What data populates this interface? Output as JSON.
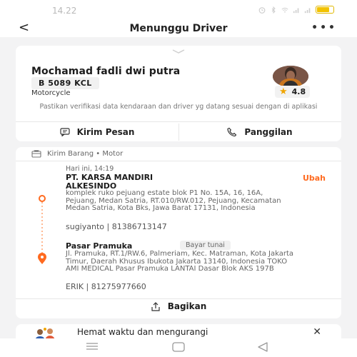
{
  "status_bar": {
    "time": "14.22"
  },
  "header": {
    "title": "Menunggu Driver",
    "back_icon": "back-arrow-icon",
    "more_icon": "more-dots-icon"
  },
  "driver": {
    "name": "Mochamad fadli dwi putra",
    "plate": "B 5089 KCL",
    "vehicle": "Motorcycle",
    "rating": "4.8",
    "verify_note": "Pastikan verifikasi data kendaraan dan driver yg datang sesuai dengan di aplikasi",
    "actions": {
      "message": "Kirim Pesan",
      "call": "Panggilan"
    }
  },
  "order": {
    "service": "Kirim Barang • Motor",
    "schedule": "Hari ini, 14:19",
    "edit": "Ubah",
    "pickup": {
      "name": "PT. KARSA MANDIRI ALKESINDO",
      "address": "komplek ruko pejuang estate blok P1 No. 15A, 16, 16A, Pejuang, Medan Satria, RT.010/RW.012, Pejuang, Kecamatan Medan Satria, Kota Bks, Jawa Barat 17131, Indonesia",
      "contact": "sugiyanto | 81386713147"
    },
    "destination": {
      "name": "Pasar Pramuka",
      "payment": "Bayar tunai",
      "address": "Jl. Pramuka, RT.1/RW.6, Palmeriam, Kec. Matraman, Kota Jakarta Timur, Daerah Khusus Ibukota Jakarta 13140, Indonesia TOKO AMI MEDICAL Pasar Pramuka LANTAI Dasar Blok AKS 197B",
      "contact": "ERIK | 81275977660"
    },
    "share": "Bagikan"
  },
  "promo": {
    "text": "Hemat waktu dan mengurangi"
  },
  "colors": {
    "accent": "#ff6a1f",
    "star": "#f0a500"
  }
}
